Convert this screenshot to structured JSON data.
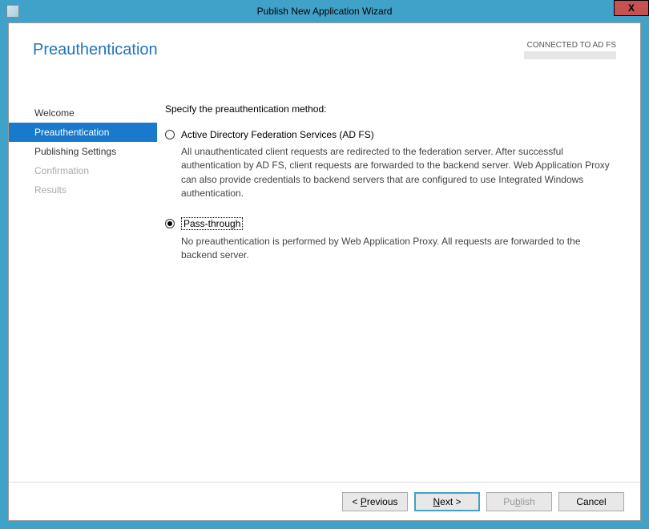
{
  "window": {
    "title": "Publish New Application Wizard",
    "close_glyph": "X"
  },
  "header": {
    "page_title": "Preauthentication",
    "connected_label": "CONNECTED TO AD FS"
  },
  "sidebar": {
    "items": [
      {
        "label": "Welcome",
        "state": "completed"
      },
      {
        "label": "Preauthentication",
        "state": "selected"
      },
      {
        "label": "Publishing Settings",
        "state": "completed"
      },
      {
        "label": "Confirmation",
        "state": "disabled"
      },
      {
        "label": "Results",
        "state": "disabled"
      }
    ]
  },
  "content": {
    "instruction": "Specify the preauthentication method:",
    "options": [
      {
        "label": "Active Directory Federation Services (AD FS)",
        "description": "All unauthenticated client requests are redirected to the federation server. After successful authentication by AD FS, client requests are forwarded to the backend server. Web Application Proxy can also provide credentials to backend servers that are configured to use Integrated Windows authentication.",
        "selected": false,
        "focused": false
      },
      {
        "label": "Pass-through",
        "description": "No preauthentication is performed by Web Application Proxy. All requests are forwarded to the backend server.",
        "selected": true,
        "focused": true
      }
    ]
  },
  "buttons": {
    "previous": {
      "prefix": "< ",
      "hotkey": "P",
      "rest": "revious",
      "enabled": true
    },
    "next": {
      "hotkey": "N",
      "rest": "ext >",
      "enabled": true,
      "default": true
    },
    "publish": {
      "prefix": "Pu",
      "hotkey": "b",
      "rest": "lish",
      "enabled": false
    },
    "cancel": {
      "label": "Cancel",
      "enabled": true
    }
  }
}
